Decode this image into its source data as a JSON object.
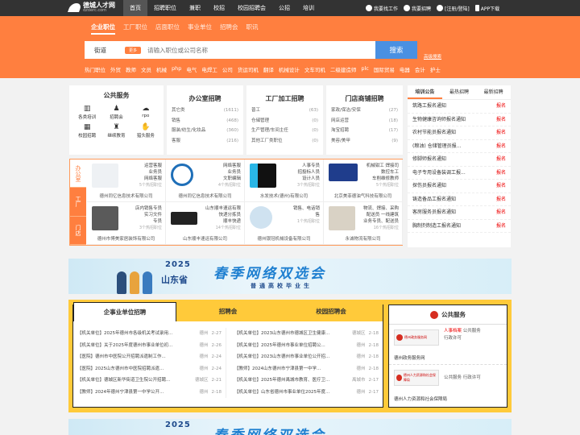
{
  "site": {
    "name": "德城人才网",
    "url": "dzderc.com"
  },
  "nav": [
    "首页",
    "招聘职位",
    "兼职",
    "校招",
    "校园招聘会",
    "公招",
    "培训"
  ],
  "top_right": [
    "我要找工作",
    "我要招聘",
    "[注册/登陆]",
    "APP下载"
  ],
  "subtabs": [
    "企业职位",
    "工厂职位",
    "店面职位",
    "事业单位",
    "招聘会",
    "职讯"
  ],
  "search": {
    "city": "街道",
    "my_label": "更多",
    "placeholder": "请输入职位或公司名称",
    "button": "搜索",
    "advanced": "高级搜索"
  },
  "categories": [
    "热门职位",
    "外贸",
    "教师",
    "文员",
    "机械",
    "php",
    "电气",
    "电焊工",
    "公司",
    "货运司机",
    "翻译",
    "机械设计",
    "文车司机",
    "二级建造师",
    "plc",
    "国际贸易",
    "电器",
    "会计",
    "护士"
  ],
  "services": {
    "title": "公共服务",
    "items": [
      "各类培训",
      "招聘会",
      "rpo",
      "校园招聘",
      "继续教育",
      "猎头服务"
    ]
  },
  "job_boxes": [
    {
      "title": "办公室招聘",
      "rows": [
        [
          "其它类",
          "(1611)"
        ],
        [
          "销售",
          "(468)"
        ],
        [
          "服装/纺生/化妆品",
          "(360)"
        ],
        [
          "客服",
          "(216)"
        ]
      ]
    },
    {
      "title": "工厂加工招聘",
      "rows": [
        [
          "普工",
          "(63)"
        ],
        [
          "仓储管理",
          "(0)"
        ],
        [
          "生产管理/车间主任",
          "(0)"
        ],
        [
          "其他工厂类职位",
          "(0)"
        ]
      ]
    },
    {
      "title": "门店商铺招聘",
      "rows": [
        [
          "家政/保洁/安保",
          "(27)"
        ],
        [
          "网店运营",
          "(18)"
        ],
        [
          "淘宝招聘",
          "(17)"
        ],
        [
          "美容/美甲",
          "(9)"
        ]
      ]
    }
  ],
  "ad_side": [
    "办公室",
    "工厂",
    "门店"
  ],
  "ads": [
    {
      "lines": [
        "运营客服",
        "业务员",
        "网络客服"
      ],
      "count": "5个热招职位",
      "company": "德州同亿信息技术有限公司"
    },
    {
      "lines": [
        "网络客服",
        "业务员",
        "文职编辑"
      ],
      "count": "4个热招职位",
      "company": "德州同亿信息技术有限公司"
    },
    {
      "lines": [
        "人事专员",
        "招投标人员",
        "设计人员"
      ],
      "count": "3个热招职位",
      "company": "水发技术(德州)有限公司"
    },
    {
      "lines": [
        "机械钳工 焊接司",
        "数控车工",
        "车削维修教师"
      ],
      "count": "5个热招职位",
      "company": "北京美菲德油气科技有限公司"
    },
    {
      "lines": [
        "店内销售专员",
        "实习文件",
        "专员"
      ],
      "count": "3个热招职位",
      "company": "德州市博美家居装饰有限公司"
    },
    {
      "lines": [
        "山东顺丰速运有限",
        "快递分拣员",
        "顺丰快递"
      ],
      "count": "14个热招职位",
      "company": "山东顺丰速运有限公司"
    },
    {
      "lines": [
        "销售、电话销",
        "售"
      ],
      "count": "1个热招职位",
      "company": "德州银冠机械设备有限公司"
    },
    {
      "lines": [
        "物流、焊接、采购",
        "配送员 一线建筑",
        "业务专员、配送员"
      ],
      "count": "16个热招职位",
      "company": "永诚物流有限公司"
    }
  ],
  "news": {
    "tabs": [
      "培训公告",
      "最热招聘",
      "最新招聘"
    ],
    "rows": [
      [
        "筑路工报名通知",
        "报名"
      ],
      [
        "生物健康咨询师报名通知",
        "报名"
      ],
      [
        "农村节能员报名通知",
        "报名"
      ],
      [
        "(粮油) 仓储管理员报...",
        "报名"
      ],
      [
        "修脚师报名通知",
        "报名"
      ],
      [
        "电子专用设备装调工报...",
        "报名"
      ],
      [
        "探伤员报名通知",
        "报名"
      ],
      [
        "铸造备品工报名通知",
        "报名"
      ],
      [
        "客房服务员报名通知",
        "报名"
      ],
      [
        "胸制剂制造工报名通知",
        "报名"
      ]
    ]
  },
  "banner": {
    "year": "2025",
    "province": "山东省",
    "title": "春季网络双选会",
    "subtitle": "普通高校毕业生"
  },
  "banner2": {
    "year": "2025",
    "title": "春季网络双选会"
  },
  "job_tabs": [
    "企事业单位招聘",
    "招聘会",
    "校园招聘会"
  ],
  "jobs_left": [
    [
      "【机关单位】2025年德州市各级机关考试录用...",
      "德州",
      "2-27"
    ],
    [
      "【机关单位】关于2025年度德州市事业单位初...",
      "德州",
      "2-26"
    ],
    [
      "【医院】德州市中医院公开招聘派遣制工作...",
      "德州",
      "2-24"
    ],
    [
      "【医院】2025山东德州市中医院招聘派遣...",
      "德州",
      "2-24"
    ],
    [
      "【机关单位】德城区新华街道卫生院公开招聘...",
      "德城区",
      "2-21"
    ],
    [
      "【教师】2024年德州宁津县第一中学公开...",
      "德州",
      "2-18"
    ]
  ],
  "jobs_right": [
    [
      "【机关单位】2023山东德州市德城区卫生健康...",
      "德城区",
      "2-18"
    ],
    [
      "【机关单位】2025年德州市事业单位招聘公...",
      "德州",
      "2-18"
    ],
    [
      "【机关单位】2023山东德州市事业单位公开招...",
      "德州",
      "2-18"
    ],
    [
      "【教师】2024山东德州市宁津县第一中学...",
      "德州",
      "2-18"
    ],
    [
      "【机关单位】2025年德州禹城市教育、医疗卫...",
      "禹城市",
      "2-17"
    ],
    [
      "【机关单位】山东省德州市事业单位2025年度...",
      "德州",
      "2-17"
    ]
  ],
  "public_service": {
    "title": "公共服务",
    "items": [
      {
        "badge": "德州政务服务网",
        "links": [
          "人事档案",
          "公共服务",
          "行政许可"
        ],
        "name": "德州政务服务网"
      },
      {
        "badge": "德州人力资源和社会保障局",
        "links": [
          "公共服务",
          "行政许可"
        ],
        "name": "德州人力资源和社会保障局"
      }
    ]
  },
  "colors": {
    "brand": "#ff7f3f",
    "search_button": "#4a90e2",
    "dark_bar": "#333333",
    "highlight": "#ffca3a"
  }
}
